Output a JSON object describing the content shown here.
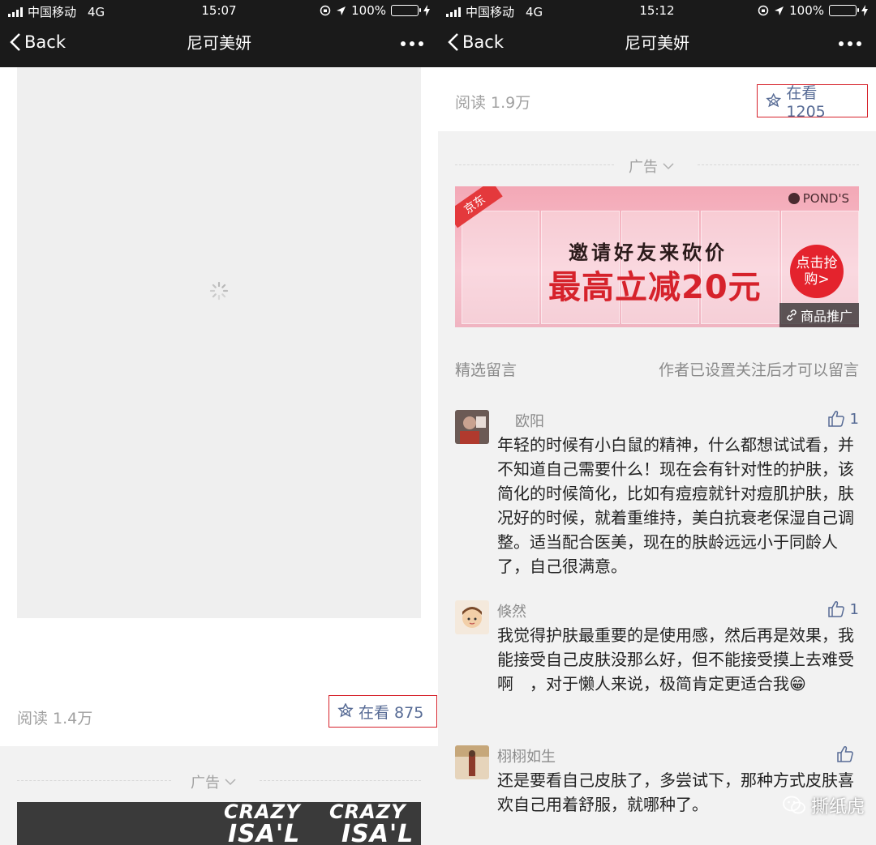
{
  "left": {
    "status": {
      "carrier": "中国移动",
      "network": "4G",
      "time": "15:07",
      "battery": "100%"
    },
    "nav": {
      "back_label": "Back",
      "title": "尼可美妍"
    },
    "stats": {
      "reads": "阅读 1.4万",
      "watching": "在看 875"
    },
    "ad": {
      "label": "广告",
      "banner_text_1": "CRAZY",
      "banner_text_2": "CRAZY",
      "banner_text_3": "ISA'L",
      "banner_text_4": "ISA'L"
    }
  },
  "right": {
    "status": {
      "carrier": "中国移动",
      "network": "4G",
      "time": "15:12",
      "battery": "100%"
    },
    "nav": {
      "back_label": "Back",
      "title": "尼可美妍"
    },
    "stats": {
      "reads": "阅读 1.9万",
      "watching": "在看 1205"
    },
    "ad": {
      "label": "广告",
      "jd": "京东",
      "brand": "POND'S",
      "line1": "邀请好友来砍价",
      "line2": "最高立减20元",
      "cta": "点击抢购>",
      "promo": "商品推广"
    },
    "comments_section": {
      "title": "精选留言",
      "note": "作者已设置关注后才可以留言"
    },
    "comments": [
      {
        "author": "欧阳",
        "likes": "1",
        "content": "年轻的时候有小白鼠的精神，什么都想试试看，并不知道自己需要什么！现在会有针对性的护肤，该简化的时候简化，比如有痘痘就针对痘肌护肤，肤况好的时候，就着重维持，美白抗衰老保湿自己调整。适当配合医美，现在的肤龄远远小于同龄人了，自己很满意。"
      },
      {
        "author": "倏然",
        "likes": "1",
        "content": "我觉得护肤最重要的是使用感，然后再是效果，我能接受自己皮肤没那么好，但不能接受摸上去难受啊　，对于懒人来说，极简肯定更适合我😁"
      },
      {
        "author": "栩栩如生",
        "likes": "",
        "content": "还是要看自己皮肤了，多尝试下，那种方式皮肤喜欢自己用着舒服，就哪种了。"
      }
    ],
    "watermark": "撕纸虎"
  },
  "colors": {
    "nav_bg": "#1a1a1a",
    "link": "#576b95",
    "highlight_border": "#d6222b",
    "battery": "#4cd964"
  }
}
